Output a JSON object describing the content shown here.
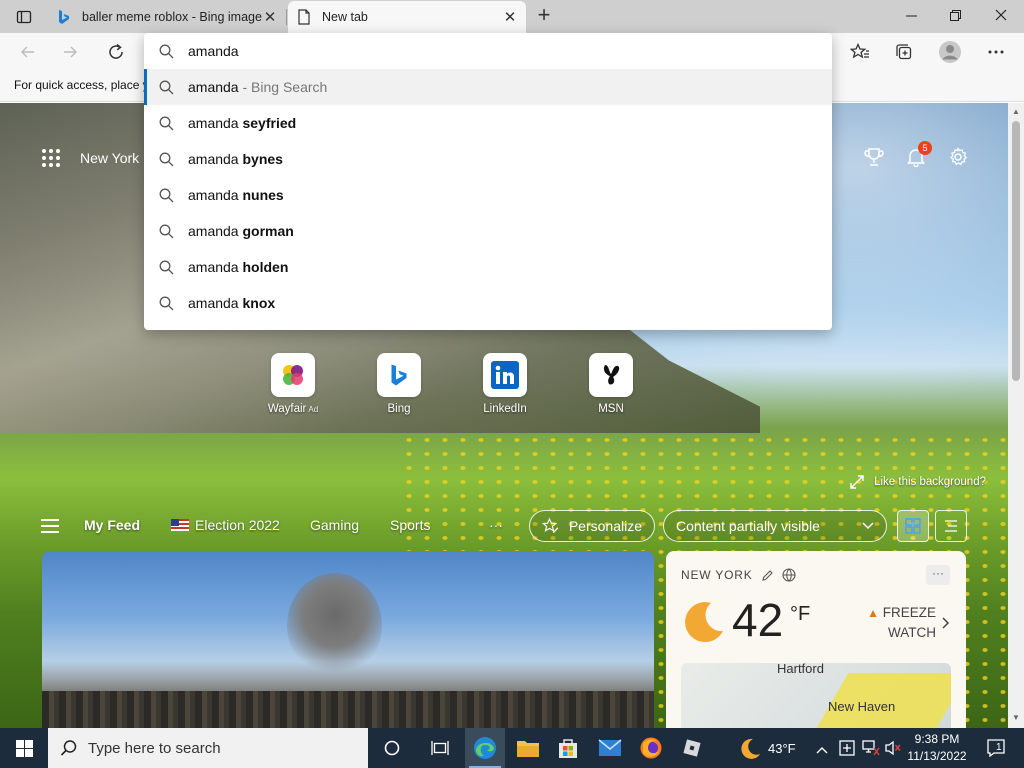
{
  "tabs": [
    {
      "title": "baller meme roblox - Bing image",
      "active": false
    },
    {
      "title": "New tab",
      "active": true
    }
  ],
  "toolbar": {
    "favorites_hint": "For quick access, place y"
  },
  "omnibox": {
    "query": "amanda",
    "suggestions": [
      {
        "base": "amanda",
        "suffix": " - Bing Search",
        "muted": true
      },
      {
        "base": "amanda ",
        "suffix": "seyfried",
        "muted": false
      },
      {
        "base": "amanda ",
        "suffix": "bynes",
        "muted": false
      },
      {
        "base": "amanda ",
        "suffix": "nunes",
        "muted": false
      },
      {
        "base": "amanda ",
        "suffix": "gorman",
        "muted": false
      },
      {
        "base": "amanda ",
        "suffix": "holden",
        "muted": false
      },
      {
        "base": "amanda ",
        "suffix": "knox",
        "muted": false
      }
    ]
  },
  "newtab": {
    "location": "New York",
    "notification_count": "5",
    "quick_links": [
      {
        "label": "Wayfair",
        "ad": "Ad"
      },
      {
        "label": "Bing",
        "ad": ""
      },
      {
        "label": "LinkedIn",
        "ad": ""
      },
      {
        "label": "MSN",
        "ad": ""
      }
    ],
    "like_background": "Like this background?",
    "feed": {
      "my_feed": "My Feed",
      "election": "Election 2022",
      "gaming": "Gaming",
      "sports": "Sports",
      "more": "···",
      "personalize": "Personalize",
      "content_visibility": "Content partially visible"
    },
    "weather": {
      "location": "NEW YORK",
      "temp": "42",
      "unit": "°F",
      "alert_line1": "FREEZE",
      "alert_line2": "WATCH",
      "map_city1": "Hartford",
      "map_city2": "New Haven"
    }
  },
  "taskbar": {
    "search_placeholder": "Type here to search",
    "weather": "43°F",
    "time": "9:38 PM",
    "date": "11/13/2022",
    "notification_count": "1"
  },
  "colors": {
    "accent": "#0f6cbd",
    "taskbar": "#1c2c3c",
    "badge": "#e8441c"
  }
}
